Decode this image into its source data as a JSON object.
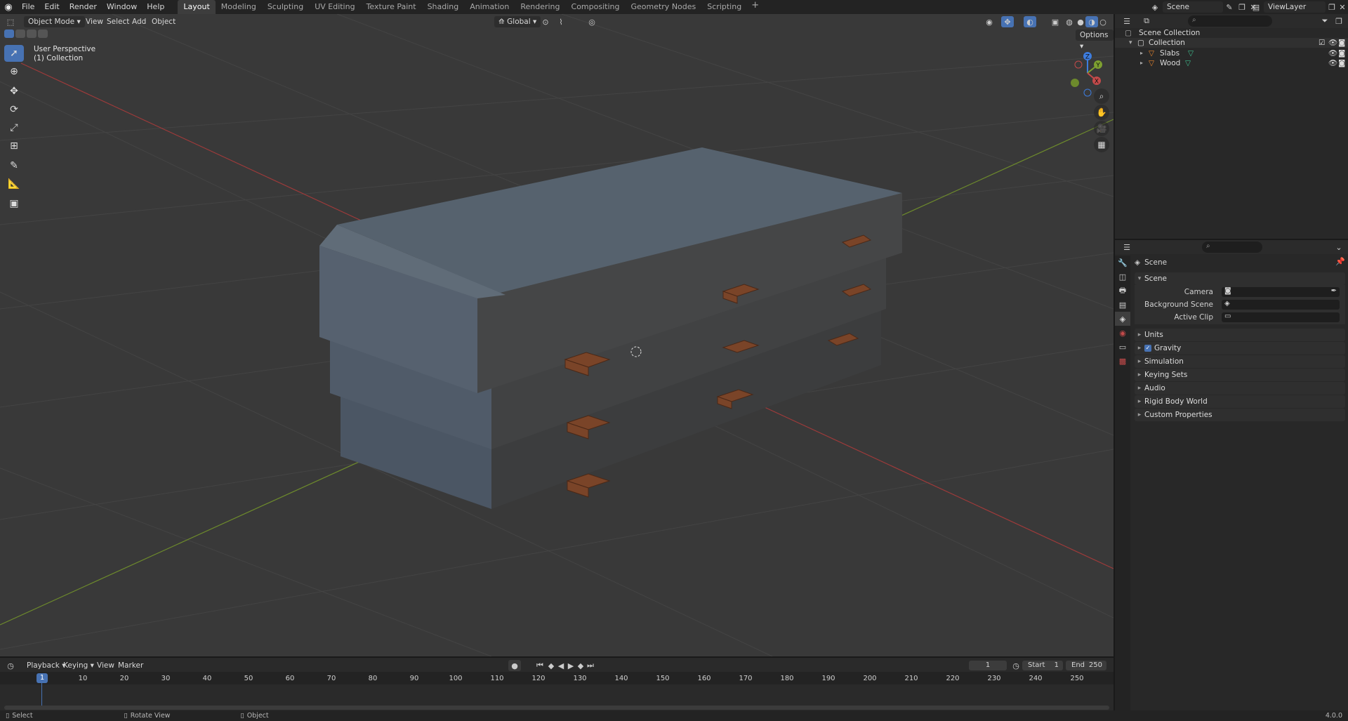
{
  "topbar": {
    "menus": [
      "File",
      "Edit",
      "Render",
      "Window",
      "Help"
    ],
    "workspaces": [
      "Layout",
      "Modeling",
      "Sculpting",
      "UV Editing",
      "Texture Paint",
      "Shading",
      "Animation",
      "Rendering",
      "Compositing",
      "Geometry Nodes",
      "Scripting"
    ],
    "active_workspace": "Layout",
    "add_tab": "+",
    "scene_name": "Scene",
    "view_layer_name": "ViewLayer"
  },
  "viewport": {
    "mode": "Object Mode",
    "menus": [
      "View",
      "Select",
      "Add",
      "Object"
    ],
    "transform_orientation": "Global",
    "options_label": "Options",
    "overlay_title": "User Perspective",
    "overlay_collection": "(1) Collection",
    "gizmo_axes": {
      "x": "X",
      "y": "Y",
      "z": "Z"
    }
  },
  "outliner": {
    "root": "Scene Collection",
    "collection": "Collection",
    "items": [
      "Slabs",
      "Wood"
    ]
  },
  "properties": {
    "context_title": "Scene",
    "panel_scene": "Scene",
    "fields": [
      {
        "label": "Camera"
      },
      {
        "label": "Background Scene"
      },
      {
        "label": "Active Clip"
      }
    ],
    "panels": [
      "Units",
      "Gravity",
      "Simulation",
      "Keying Sets",
      "Audio",
      "Rigid Body World",
      "Custom Properties"
    ],
    "gravity_checked": true
  },
  "timeline": {
    "menus": [
      "Playback",
      "Keying",
      "View",
      "Marker"
    ],
    "current_frame": "1",
    "start_label": "Start",
    "start_value": "1",
    "end_label": "End",
    "end_value": "250",
    "frame_marker": "1",
    "ruler": [
      "10",
      "20",
      "30",
      "40",
      "50",
      "60",
      "70",
      "80",
      "90",
      "100",
      "110",
      "120",
      "130",
      "140",
      "150",
      "160",
      "170",
      "180",
      "190",
      "200",
      "210",
      "220",
      "230",
      "240",
      "250"
    ]
  },
  "statusbar": {
    "select": "Select",
    "rotate": "Rotate View",
    "object": "Object",
    "version": "4.0.0"
  },
  "colors": {
    "accent": "#4772b3",
    "viewport_bg": "#393939",
    "x_axis": "#c44a4a",
    "y_axis": "#7ea030",
    "z_axis": "#3d7de0",
    "mesh_orange": "#e9852d"
  }
}
